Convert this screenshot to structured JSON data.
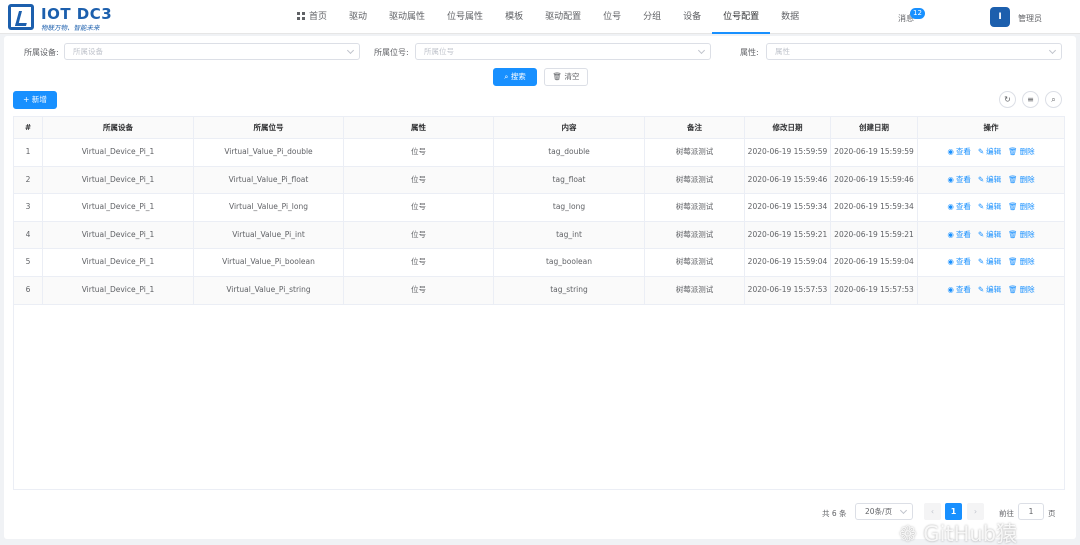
{
  "app": {
    "title": "IOT DC3",
    "slogan": "物联万物、智能未来"
  },
  "nav": {
    "items": [
      {
        "label": "首页"
      },
      {
        "label": "驱动"
      },
      {
        "label": "驱动属性"
      },
      {
        "label": "位号属性"
      },
      {
        "label": "模板"
      },
      {
        "label": "驱动配置"
      },
      {
        "label": "位号"
      },
      {
        "label": "分组"
      },
      {
        "label": "设备"
      },
      {
        "label": "位号配置"
      },
      {
        "label": "数据"
      }
    ],
    "active": "位号配置"
  },
  "header": {
    "message_label": "消息",
    "message_count": "12",
    "admin_label": "管理员"
  },
  "filters": {
    "device_label": "所属设备:",
    "device_placeholder": "所属设备",
    "point_label": "所属位号:",
    "point_placeholder": "所属位号",
    "attr_label": "属性:",
    "attr_placeholder": "属性"
  },
  "buttons": {
    "search": "搜索",
    "reset": "清空",
    "add": "新增"
  },
  "table": {
    "columns": [
      "#",
      "所属设备",
      "所属位号",
      "属性",
      "内容",
      "备注",
      "修改日期",
      "创建日期",
      "操作"
    ],
    "rows": [
      {
        "idx": "1",
        "device": "Virtual_Device_Pi_1",
        "point": "Virtual_Value_Pi_double",
        "attr": "位号",
        "content": "tag_double",
        "remark": "树莓派测试",
        "updated": "2020-06-19 15:59:59",
        "created": "2020-06-19 15:59:59"
      },
      {
        "idx": "2",
        "device": "Virtual_Device_Pi_1",
        "point": "Virtual_Value_Pi_float",
        "attr": "位号",
        "content": "tag_float",
        "remark": "树莓派测试",
        "updated": "2020-06-19 15:59:46",
        "created": "2020-06-19 15:59:46"
      },
      {
        "idx": "3",
        "device": "Virtual_Device_Pi_1",
        "point": "Virtual_Value_Pi_long",
        "attr": "位号",
        "content": "tag_long",
        "remark": "树莓派测试",
        "updated": "2020-06-19 15:59:34",
        "created": "2020-06-19 15:59:34"
      },
      {
        "idx": "4",
        "device": "Virtual_Device_Pi_1",
        "point": "Virtual_Value_Pi_int",
        "attr": "位号",
        "content": "tag_int",
        "remark": "树莓派测试",
        "updated": "2020-06-19 15:59:21",
        "created": "2020-06-19 15:59:21"
      },
      {
        "idx": "5",
        "device": "Virtual_Device_Pi_1",
        "point": "Virtual_Value_Pi_boolean",
        "attr": "位号",
        "content": "tag_boolean",
        "remark": "树莓派测试",
        "updated": "2020-06-19 15:59:04",
        "created": "2020-06-19 15:59:04"
      },
      {
        "idx": "6",
        "device": "Virtual_Device_Pi_1",
        "point": "Virtual_Value_Pi_string",
        "attr": "位号",
        "content": "tag_string",
        "remark": "树莓派测试",
        "updated": "2020-06-19 15:57:53",
        "created": "2020-06-19 15:57:53"
      }
    ],
    "actions": {
      "view": "查看",
      "edit": "编辑",
      "delete": "删除"
    }
  },
  "pagination": {
    "total": "共 6 条",
    "page_size": "20条/页",
    "current_page": "1",
    "goto_label": "前往",
    "goto_value": "1",
    "page_unit": "页"
  },
  "watermark": "GitHub猿",
  "colors": {
    "primary": "#1890ff",
    "brand": "#1c5fad"
  }
}
